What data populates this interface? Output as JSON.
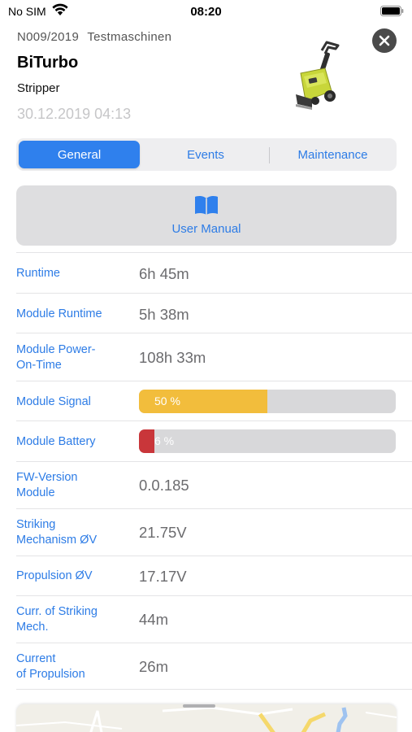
{
  "status_bar": {
    "carrier": "No SIM",
    "time": "08:20"
  },
  "header": {
    "machine_number": "N009/2019",
    "machine_group": "Testmaschinen",
    "title": "BiTurbo",
    "subtitle": "Stripper",
    "timestamp": "30.12.2019 04:13"
  },
  "tabs": [
    {
      "label": "General",
      "active": true
    },
    {
      "label": "Events",
      "active": false
    },
    {
      "label": "Maintenance",
      "active": false
    }
  ],
  "manual": {
    "label": "User Manual",
    "icon": "book-icon"
  },
  "details": [
    {
      "label": "Runtime",
      "value": "6h 45m"
    },
    {
      "label": "Module Runtime",
      "value": "5h 38m"
    },
    {
      "label": "Module Power-\nOn-Time",
      "value": "108h 33m"
    },
    {
      "label": "Module Signal",
      "value": "50 %",
      "level": 0.5,
      "color": "#f2bd3c"
    },
    {
      "label": "Module Battery",
      "value": "6 %",
      "level": 0.06,
      "color": "#c9363a"
    },
    {
      "label": "FW-Version\nModule",
      "value": "0.0.185"
    },
    {
      "label": "Striking\nMechanism ØV",
      "value": "21.75V"
    },
    {
      "label": "Propulsion ØV",
      "value": "17.17V"
    },
    {
      "label": "Curr. of Striking\nMech.",
      "value": "44m"
    },
    {
      "label": "Current\nof Propulsion",
      "value": "26m"
    }
  ],
  "colors": {
    "accent": "#2f80ed",
    "link": "#2d7ce6",
    "machine_body": "#c8d63a"
  }
}
